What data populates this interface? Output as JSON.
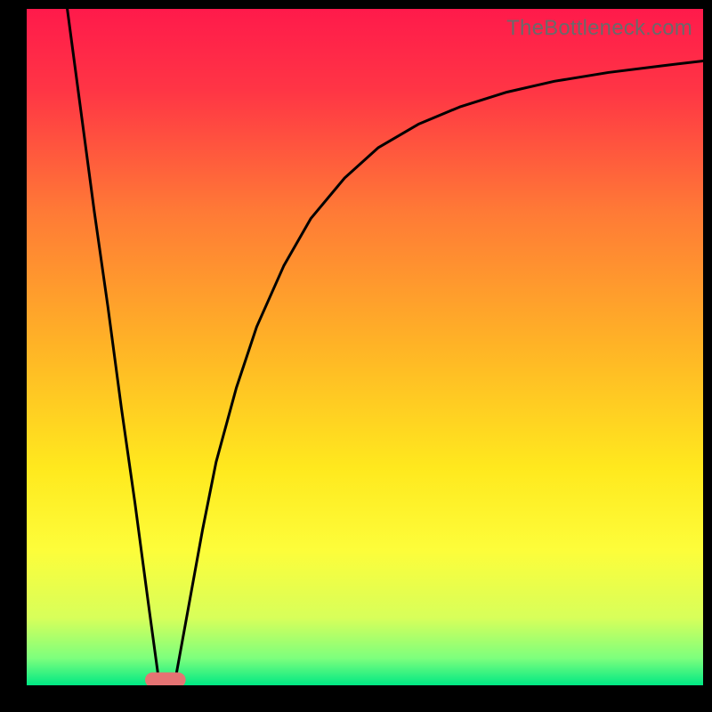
{
  "watermark": "TheBottleneck.com",
  "chart_data": {
    "type": "line",
    "title": "",
    "xlabel": "",
    "ylabel": "",
    "xlim": [
      0,
      100
    ],
    "ylim": [
      0,
      100
    ],
    "grid": false,
    "legend": false,
    "background_gradient": {
      "direction": "vertical",
      "stops": [
        {
          "pos": 0.0,
          "color": "#ff1a4b"
        },
        {
          "pos": 0.12,
          "color": "#ff3545"
        },
        {
          "pos": 0.3,
          "color": "#ff7a36"
        },
        {
          "pos": 0.5,
          "color": "#ffb426"
        },
        {
          "pos": 0.68,
          "color": "#ffe91e"
        },
        {
          "pos": 0.8,
          "color": "#fdfd3a"
        },
        {
          "pos": 0.9,
          "color": "#d8ff5a"
        },
        {
          "pos": 0.96,
          "color": "#7dff7d"
        },
        {
          "pos": 1.0,
          "color": "#00e884"
        }
      ]
    },
    "series": [
      {
        "name": "left-branch",
        "stroke": "#000000",
        "stroke_width": 3,
        "x": [
          6,
          8,
          10,
          12,
          14,
          16,
          18,
          19.5
        ],
        "y": [
          100,
          85,
          70,
          56,
          41,
          27,
          12,
          1
        ]
      },
      {
        "name": "right-branch",
        "stroke": "#000000",
        "stroke_width": 3,
        "x": [
          22,
          24,
          26,
          28,
          31,
          34,
          38,
          42,
          47,
          52,
          58,
          64,
          71,
          78,
          86,
          94,
          100
        ],
        "y": [
          1,
          12,
          23,
          33,
          44,
          53,
          62,
          69,
          75,
          79.5,
          83,
          85.5,
          87.7,
          89.3,
          90.6,
          91.6,
          92.3
        ]
      }
    ],
    "marker": {
      "name": "bottleneck-pill",
      "shape": "pill",
      "cx": 20.5,
      "cy": 0.8,
      "w": 6,
      "h": 2.2,
      "fill": "#e57373"
    }
  }
}
